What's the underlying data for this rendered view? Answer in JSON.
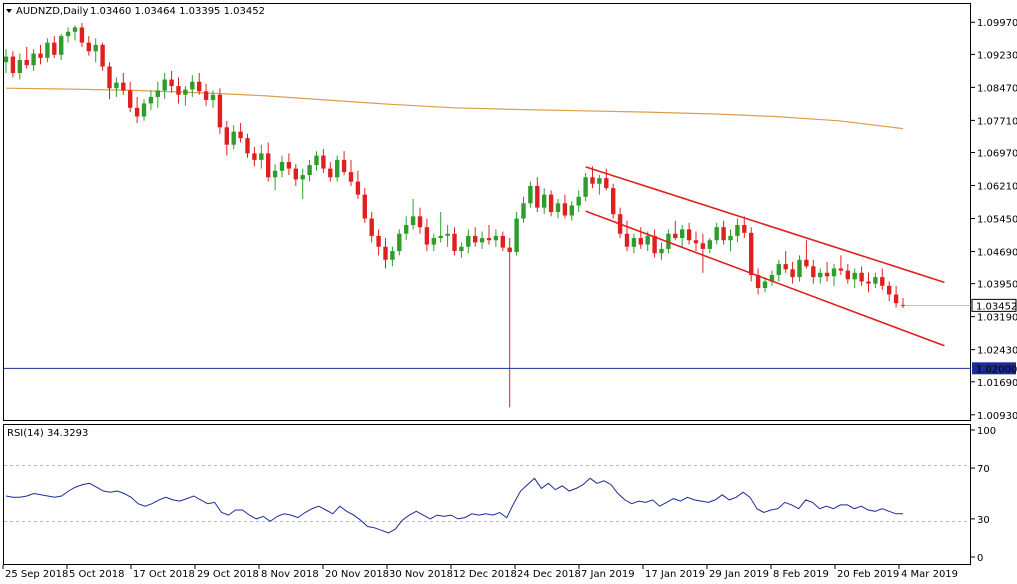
{
  "header": {
    "symbol": "AUDNZD,Daily",
    "ohlc": "1.03460 1.03464 1.03395 1.03452"
  },
  "rsi_header": "RSI(14) 34.3293",
  "colors": {
    "bull": "#2e9d2e",
    "bear": "#e02020",
    "ma": "#daa04a",
    "channel": "#e02020",
    "hline": "#1c2c94",
    "rsi": "#1c2c94",
    "grid": "#bbbbbb",
    "price_badge": "#ffffff",
    "hline_badge": "#1c2c94"
  },
  "chart_data": {
    "type": "candlestick",
    "price_axis": {
      "range": [
        1.0081,
        1.1039
      ],
      "ticks": [
        "1.09970",
        "1.09230",
        "1.08470",
        "1.07710",
        "1.06970",
        "1.06210",
        "1.05450",
        "1.04690",
        "1.03950",
        "1.03190",
        "1.02430",
        "1.01690",
        "1.00930"
      ],
      "current_price_label": "1.03452",
      "hline_label": "1.02000"
    },
    "date_labels": [
      "25 Sep 2018",
      "5 Oct 2018",
      "17 Oct 2018",
      "29 Oct 2018",
      "8 Nov 2018",
      "20 Nov 2018",
      "30 Nov 2018",
      "12 Dec 2018",
      "24 Dec 2018",
      "7 Jan 2019",
      "17 Jan 2019",
      "29 Jan 2019",
      "8 Feb 2019",
      "20 Feb 2019",
      "4 Mar 2019"
    ],
    "candles_ohlc": [
      [
        1.0905,
        1.0935,
        1.088,
        1.0918
      ],
      [
        1.0918,
        1.093,
        1.087,
        1.088
      ],
      [
        1.088,
        1.0925,
        1.0865,
        1.091
      ],
      [
        1.091,
        1.094,
        1.089,
        1.0898
      ],
      [
        1.0898,
        1.0935,
        1.0885,
        1.0925
      ],
      [
        1.0925,
        1.0945,
        1.09,
        1.0915
      ],
      [
        1.0915,
        1.096,
        1.0905,
        1.095
      ],
      [
        1.095,
        1.0965,
        1.0915,
        1.0922
      ],
      [
        1.0922,
        1.097,
        1.091,
        1.0965
      ],
      [
        1.0965,
        1.0985,
        1.095,
        1.0975
      ],
      [
        1.0975,
        1.099,
        1.0955,
        1.0985
      ],
      [
        1.0985,
        1.0995,
        1.094,
        1.095
      ],
      [
        1.095,
        1.0965,
        1.092,
        1.093
      ],
      [
        1.093,
        1.096,
        1.0905,
        1.0945
      ],
      [
        1.0945,
        1.095,
        1.0885,
        1.0895
      ],
      [
        1.0895,
        1.0905,
        1.082,
        1.0845
      ],
      [
        1.0845,
        1.087,
        1.0825,
        1.0858
      ],
      [
        1.0858,
        1.088,
        1.083,
        1.084
      ],
      [
        1.084,
        1.086,
        1.079,
        1.08
      ],
      [
        1.08,
        1.0825,
        1.0765,
        1.078
      ],
      [
        1.078,
        1.082,
        1.077,
        1.081
      ],
      [
        1.081,
        1.084,
        1.0795,
        1.0825
      ],
      [
        1.0825,
        1.086,
        1.08,
        1.084
      ],
      [
        1.084,
        1.088,
        1.082,
        1.0865
      ],
      [
        1.0865,
        1.0885,
        1.0835,
        1.085
      ],
      [
        1.085,
        1.087,
        1.081,
        1.083
      ],
      [
        1.083,
        1.085,
        1.0805,
        1.0842
      ],
      [
        1.0842,
        1.0875,
        1.0825,
        1.086
      ],
      [
        1.086,
        1.088,
        1.083,
        1.0838
      ],
      [
        1.0838,
        1.0855,
        1.0805,
        1.0818
      ],
      [
        1.0818,
        1.084,
        1.08,
        1.083
      ],
      [
        1.083,
        1.0845,
        1.074,
        1.0755
      ],
      [
        1.0755,
        1.077,
        1.069,
        1.0715
      ],
      [
        1.0715,
        1.076,
        1.0705,
        1.0745
      ],
      [
        1.0745,
        1.0765,
        1.072,
        1.073
      ],
      [
        1.073,
        1.074,
        1.0685,
        1.0695
      ],
      [
        1.0695,
        1.071,
        1.0665,
        1.068
      ],
      [
        1.068,
        1.0715,
        1.066,
        1.0695
      ],
      [
        1.0695,
        1.072,
        1.063,
        1.064
      ],
      [
        1.064,
        1.067,
        1.061,
        1.0655
      ],
      [
        1.0655,
        1.069,
        1.064,
        1.0675
      ],
      [
        1.0675,
        1.0695,
        1.0645,
        1.066
      ],
      [
        1.066,
        1.067,
        1.062,
        1.0635
      ],
      [
        1.0635,
        1.066,
        1.059,
        1.0645
      ],
      [
        1.0645,
        1.068,
        1.063,
        1.0668
      ],
      [
        1.0668,
        1.07,
        1.0655,
        1.069
      ],
      [
        1.069,
        1.0705,
        1.065,
        1.066
      ],
      [
        1.066,
        1.0675,
        1.063,
        1.064
      ],
      [
        1.064,
        1.069,
        1.063,
        1.068
      ],
      [
        1.068,
        1.07,
        1.0645,
        1.0652
      ],
      [
        1.0652,
        1.068,
        1.062,
        1.063
      ],
      [
        1.063,
        1.0655,
        1.059,
        1.06
      ],
      [
        1.06,
        1.0615,
        1.0535,
        1.0545
      ],
      [
        1.0545,
        1.056,
        1.049,
        1.0505
      ],
      [
        1.0505,
        1.052,
        1.046,
        1.048
      ],
      [
        1.048,
        1.05,
        1.043,
        1.045
      ],
      [
        1.045,
        1.048,
        1.0435,
        1.047
      ],
      [
        1.047,
        1.052,
        1.046,
        1.051
      ],
      [
        1.051,
        1.055,
        1.0495,
        1.053
      ],
      [
        1.053,
        1.059,
        1.052,
        1.055
      ],
      [
        1.055,
        1.057,
        1.051,
        1.0525
      ],
      [
        1.0525,
        1.0545,
        1.047,
        1.0485
      ],
      [
        1.0485,
        1.051,
        1.047,
        1.05
      ],
      [
        1.05,
        1.056,
        1.049,
        1.0505
      ],
      [
        1.0505,
        1.053,
        1.048,
        1.051
      ],
      [
        1.051,
        1.0525,
        1.046,
        1.047
      ],
      [
        1.047,
        1.049,
        1.0455,
        1.048
      ],
      [
        1.048,
        1.052,
        1.0465,
        1.0505
      ],
      [
        1.0505,
        1.0525,
        1.048,
        1.049
      ],
      [
        1.049,
        1.0515,
        1.0475,
        1.05
      ],
      [
        1.05,
        1.053,
        1.0485,
        1.0495
      ],
      [
        1.0495,
        1.052,
        1.048,
        1.0505
      ],
      [
        1.0505,
        1.0515,
        1.047,
        1.0478
      ],
      [
        1.0478,
        1.05,
        1.011,
        1.0468
      ],
      [
        1.0468,
        1.056,
        1.046,
        1.0545
      ],
      [
        1.0545,
        1.0595,
        1.0535,
        1.058
      ],
      [
        1.058,
        1.063,
        1.057,
        1.062
      ],
      [
        1.062,
        1.064,
        1.056,
        1.057
      ],
      [
        1.057,
        1.0615,
        1.0555,
        1.06
      ],
      [
        1.06,
        1.061,
        1.055,
        1.056
      ],
      [
        1.056,
        1.059,
        1.0545,
        1.058
      ],
      [
        1.058,
        1.06,
        1.0545,
        1.0552
      ],
      [
        1.0552,
        1.0585,
        1.054,
        1.0575
      ],
      [
        1.0575,
        1.061,
        1.056,
        1.0595
      ],
      [
        1.0595,
        1.065,
        1.0585,
        1.064
      ],
      [
        1.064,
        1.0665,
        1.0615,
        1.0625
      ],
      [
        1.0625,
        1.0645,
        1.06,
        1.0638
      ],
      [
        1.0638,
        1.066,
        1.061,
        1.0615
      ],
      [
        1.0615,
        1.0625,
        1.0545,
        1.0555
      ],
      [
        1.0555,
        1.057,
        1.05,
        1.051
      ],
      [
        1.051,
        1.054,
        1.047,
        1.048
      ],
      [
        1.048,
        1.051,
        1.0465,
        1.05
      ],
      [
        1.05,
        1.0525,
        1.0475,
        1.0485
      ],
      [
        1.0485,
        1.0515,
        1.047,
        1.0505
      ],
      [
        1.0505,
        1.052,
        1.0455,
        1.0465
      ],
      [
        1.0465,
        1.049,
        1.045,
        1.0475
      ],
      [
        1.0475,
        1.052,
        1.0465,
        1.051
      ],
      [
        1.051,
        1.054,
        1.0495,
        1.05
      ],
      [
        1.05,
        1.053,
        1.048,
        1.052
      ],
      [
        1.052,
        1.0535,
        1.0485,
        1.0495
      ],
      [
        1.0495,
        1.0515,
        1.047,
        1.0488
      ],
      [
        1.0488,
        1.051,
        1.042,
        1.0475
      ],
      [
        1.0475,
        1.05,
        1.0465,
        1.0495
      ],
      [
        1.0495,
        1.0535,
        1.0485,
        1.0525
      ],
      [
        1.0525,
        1.054,
        1.0485,
        1.0495
      ],
      [
        1.0495,
        1.052,
        1.047,
        1.0505
      ],
      [
        1.0505,
        1.0545,
        1.049,
        1.053
      ],
      [
        1.053,
        1.055,
        1.05,
        1.0512
      ],
      [
        1.0512,
        1.0525,
        1.04,
        1.0415
      ],
      [
        1.0415,
        1.043,
        1.037,
        1.0385
      ],
      [
        1.0385,
        1.041,
        1.0375,
        1.04
      ],
      [
        1.04,
        1.0425,
        1.039,
        1.0415
      ],
      [
        1.0415,
        1.045,
        1.04,
        1.044
      ],
      [
        1.044,
        1.047,
        1.042,
        1.0428
      ],
      [
        1.0428,
        1.0445,
        1.0395,
        1.041
      ],
      [
        1.041,
        1.046,
        1.04,
        1.045
      ],
      [
        1.045,
        1.0495,
        1.043,
        1.0435
      ],
      [
        1.0435,
        1.045,
        1.0395,
        1.041
      ],
      [
        1.041,
        1.043,
        1.0395,
        1.042
      ],
      [
        1.042,
        1.0445,
        1.04,
        1.0412
      ],
      [
        1.0412,
        1.044,
        1.039,
        1.043
      ],
      [
        1.043,
        1.046,
        1.0415,
        1.0425
      ],
      [
        1.0425,
        1.044,
        1.0395,
        1.0405
      ],
      [
        1.0405,
        1.043,
        1.0385,
        1.042
      ],
      [
        1.042,
        1.0435,
        1.039,
        1.04
      ],
      [
        1.04,
        1.042,
        1.0375,
        1.0395
      ],
      [
        1.0395,
        1.042,
        1.0385,
        1.041
      ],
      [
        1.041,
        1.043,
        1.038,
        1.039
      ],
      [
        1.039,
        1.04,
        1.0355,
        1.037
      ],
      [
        1.037,
        1.039,
        1.034,
        1.035
      ],
      [
        1.0346,
        1.0362,
        1.0339,
        1.0345
      ]
    ],
    "moving_average": [
      1.0845,
      1.0843,
      1.084,
      1.0835,
      1.0828,
      1.0818,
      1.0808,
      1.08,
      1.0796,
      1.0793,
      1.079,
      1.0786,
      1.078,
      1.077,
      1.0752
    ],
    "channel_upper": [
      [
        84,
        1.0664
      ],
      [
        136,
        1.0398
      ]
    ],
    "channel_lower": [
      [
        84,
        1.0562
      ],
      [
        136,
        1.0252
      ]
    ],
    "horizontal_line": 1.02,
    "rsi": {
      "levels": [
        "100",
        "70",
        "30",
        "0"
      ],
      "values": [
        48,
        47,
        47,
        48,
        50,
        49,
        48,
        47,
        48,
        52,
        55,
        57,
        58,
        55,
        52,
        51,
        52,
        50,
        47,
        42,
        40,
        42,
        45,
        47,
        45,
        44,
        46,
        48,
        45,
        42,
        43,
        35,
        33,
        37,
        37,
        33,
        30,
        32,
        28,
        32,
        34,
        33,
        31,
        35,
        38,
        40,
        37,
        34,
        40,
        36,
        33,
        29,
        24,
        23,
        21,
        19,
        22,
        29,
        33,
        36,
        33,
        30,
        33,
        32,
        33,
        30,
        31,
        34,
        33,
        34,
        33,
        35,
        31,
        42,
        52,
        57,
        62,
        54,
        58,
        53,
        56,
        52,
        54,
        57,
        62,
        58,
        60,
        57,
        50,
        45,
        42,
        44,
        43,
        45,
        40,
        43,
        46,
        44,
        47,
        45,
        44,
        43,
        45,
        49,
        45,
        47,
        51,
        47,
        38,
        35,
        37,
        38,
        43,
        41,
        38,
        45,
        43,
        38,
        40,
        38,
        41,
        41,
        38,
        40,
        37,
        36,
        38,
        36,
        34,
        34
      ]
    }
  }
}
